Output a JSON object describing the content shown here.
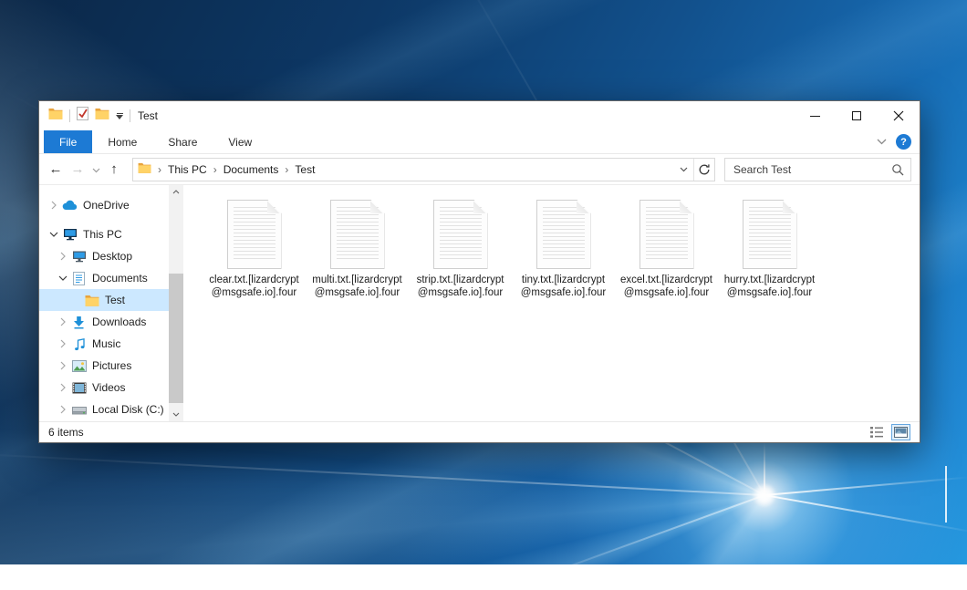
{
  "window": {
    "title": "Test",
    "controls": [
      "minimize",
      "maximize",
      "close"
    ],
    "quick_access_icons": [
      "folder-icon",
      "checkmark-document-icon",
      "folder-icon",
      "customize-toolbar-caret"
    ]
  },
  "ribbon": {
    "tabs": [
      {
        "label": "File",
        "active": true
      },
      {
        "label": "Home",
        "active": false
      },
      {
        "label": "Share",
        "active": false
      },
      {
        "label": "View",
        "active": false
      }
    ],
    "help_label": "?"
  },
  "toolbar": {
    "back": "←",
    "forward": "→",
    "up": "↑",
    "breadcrumbs": [
      "This PC",
      "Documents",
      "Test"
    ],
    "breadcrumb_separator": "›"
  },
  "search": {
    "placeholder": "Search Test"
  },
  "sidebar": {
    "items": [
      {
        "label": "OneDrive",
        "icon": "onedrive-cloud-icon",
        "state": "collapsed",
        "level": 0,
        "selected": false
      },
      {
        "label": "This PC",
        "icon": "computer-icon",
        "state": "expanded",
        "level": 0,
        "selected": false
      },
      {
        "label": "Desktop",
        "icon": "desktop-icon",
        "state": "collapsed",
        "level": 1,
        "selected": false
      },
      {
        "label": "Documents",
        "icon": "documents-icon",
        "state": "expanded",
        "level": 1,
        "selected": false
      },
      {
        "label": "Test",
        "icon": "folder-icon",
        "state": "none",
        "level": 2,
        "selected": true
      },
      {
        "label": "Downloads",
        "icon": "downloads-icon",
        "state": "collapsed",
        "level": 1,
        "selected": false
      },
      {
        "label": "Music",
        "icon": "music-icon",
        "state": "collapsed",
        "level": 1,
        "selected": false
      },
      {
        "label": "Pictures",
        "icon": "pictures-icon",
        "state": "collapsed",
        "level": 1,
        "selected": false
      },
      {
        "label": "Videos",
        "icon": "videos-icon",
        "state": "collapsed",
        "level": 1,
        "selected": false
      },
      {
        "label": "Local Disk (C:)",
        "icon": "disk-icon",
        "state": "collapsed",
        "level": 1,
        "selected": false
      }
    ]
  },
  "files": [
    {
      "name": "clear.txt.[lizardcrypt@msgsafe.io].four",
      "icon": "text-file-icon"
    },
    {
      "name": "multi.txt.[lizardcrypt@msgsafe.io].four",
      "icon": "text-file-icon"
    },
    {
      "name": "strip.txt.[lizardcrypt@msgsafe.io].four",
      "icon": "text-file-icon"
    },
    {
      "name": "tiny.txt.[lizardcrypt@msgsafe.io].four",
      "icon": "text-file-icon"
    },
    {
      "name": "excel.txt.[lizardcrypt@msgsafe.io].four",
      "icon": "text-file-icon"
    },
    {
      "name": "hurry.txt.[lizardcrypt@msgsafe.io].four",
      "icon": "text-file-icon"
    }
  ],
  "status_bar": {
    "items_count": "6 items",
    "view_toggles": [
      "details-view-icon",
      "large-icons-view-icon"
    ],
    "selected_view": "large-icons-view-icon"
  },
  "colors": {
    "accent_blue": "#1d7ad4",
    "sidebar_selection": "#cce8ff",
    "wallpaper_dark": "#0b2747",
    "wallpaper_bright": "#25a0e4",
    "folder_yellow": "#ffd367"
  }
}
